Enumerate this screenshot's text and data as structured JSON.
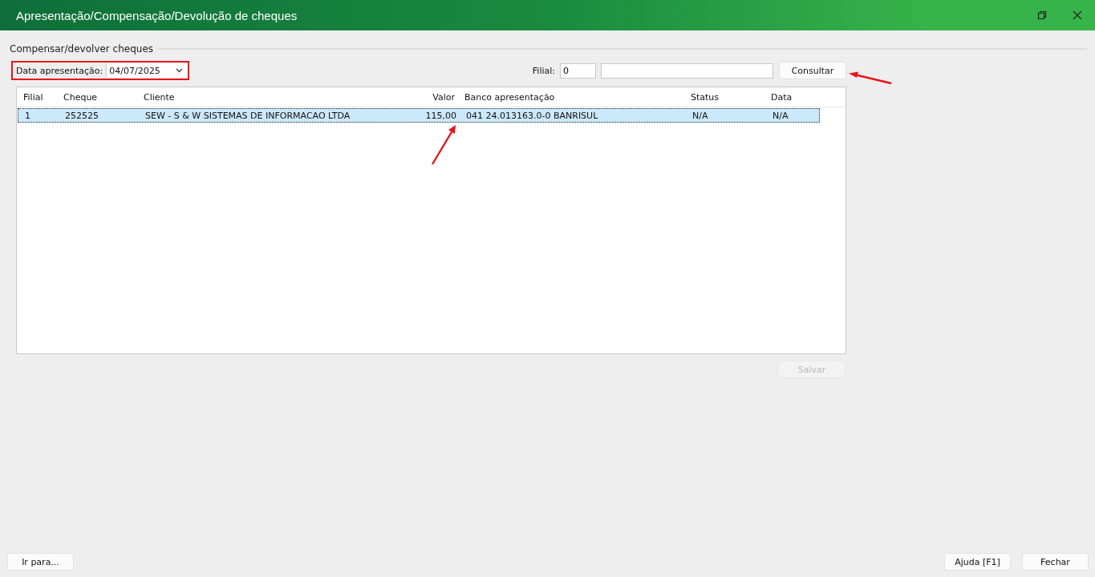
{
  "window": {
    "title": "Apresentação/Compensação/Devolução de cheques"
  },
  "group": {
    "label": "Compensar/devolver cheques"
  },
  "date_field": {
    "label": "Data apresentação:",
    "value": "04/07/2025",
    "highlighted": true
  },
  "filial_field": {
    "label": "Filial:",
    "value": "0"
  },
  "query_button": {
    "label": "Consultar"
  },
  "table": {
    "columns": [
      "Filial",
      "Cheque",
      "Cliente",
      "Valor",
      "Banco apresentação",
      "Status",
      "Data"
    ],
    "rows": [
      {
        "cells": [
          "1",
          "252525",
          "SEW - S & W SISTEMAS DE INFORMACAO LTDA",
          "115,00",
          "041 24.013163.0-0 BANRISUL",
          "N/A",
          "N/A"
        ],
        "selected": true
      }
    ]
  },
  "save_button": {
    "label": "Salvar",
    "disabled": true
  },
  "footer_left_buttons": [
    "Ir para..."
  ],
  "footer_right_buttons": [
    "Ajuda [F1]",
    "Fechar"
  ]
}
